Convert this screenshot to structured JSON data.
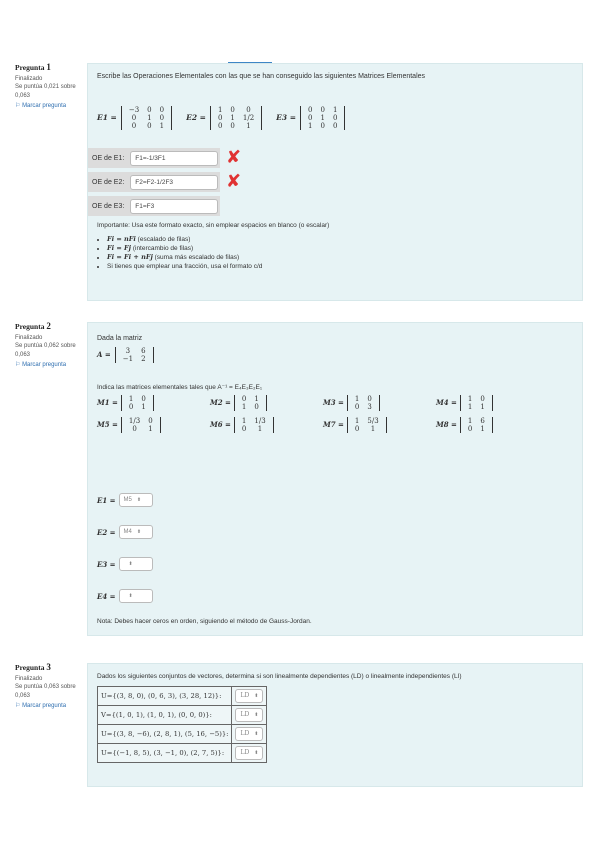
{
  "q1": {
    "info": {
      "title": "Pregunta",
      "number": "1",
      "status": "Finalizado",
      "score": "Se puntúa 0,021 sobre 0,063",
      "flag": "Marcar pregunta"
    },
    "prompt": "Escribe las Operaciones Elementales con las que se han conseguido las siguientes Matrices Elementales",
    "e1": {
      "label": "E1 =",
      "rows": [
        [
          "−3",
          "0",
          "0"
        ],
        [
          "0",
          "1",
          "0"
        ],
        [
          "0",
          "0",
          "1"
        ]
      ]
    },
    "e2": {
      "label": "E2 =",
      "rows": [
        [
          "1",
          "0",
          "0"
        ],
        [
          "0",
          "1",
          "1/2"
        ],
        [
          "0",
          "0",
          "1"
        ]
      ]
    },
    "e3": {
      "label": "E3 =",
      "rows": [
        [
          "0",
          "0",
          "1"
        ],
        [
          "0",
          "1",
          "0"
        ],
        [
          "1",
          "0",
          "0"
        ]
      ]
    },
    "answers": [
      {
        "label": "OE de E1:",
        "value": "F1=-1/3F1",
        "mark": "✘"
      },
      {
        "label": "OE de E2:",
        "value": "F2=F2-1/2F3",
        "mark": "✘"
      },
      {
        "label": "OE de E3:",
        "value": "F1=F3",
        "mark": ""
      }
    ],
    "important": "Importante: Usa este formato exacto, sin emplear espacios en blanco (o escalar)",
    "notes": [
      {
        "expr": "Fi = nFi",
        "desc": " (escalado de filas)"
      },
      {
        "expr": "Fi = Fj",
        "desc": " (intercambio de filas)"
      },
      {
        "expr": "Fi = Fi + nFj",
        "desc": " (suma más escalado de filas)"
      },
      {
        "expr": "",
        "desc": "Si tienes que emplear una fracción, usa el formato c/d"
      }
    ]
  },
  "q2": {
    "info": {
      "title": "Pregunta",
      "number": "2",
      "status": "Finalizado",
      "score": "Se puntúa 0,062 sobre 0,063",
      "flag": "Marcar pregunta"
    },
    "intro": "Dada la matriz",
    "a": {
      "label": "A =",
      "rows": [
        [
          "3",
          "6"
        ],
        [
          "−1",
          "2"
        ]
      ]
    },
    "prompt": "Indica las matrices elementales tales que A⁻¹ = E₄E₃E₂E₁",
    "mats": [
      {
        "label": "M1 =",
        "rows": [
          [
            "1",
            "0"
          ],
          [
            "0",
            "1"
          ]
        ]
      },
      {
        "label": "M2 =",
        "rows": [
          [
            "0",
            "1"
          ],
          [
            "1",
            "0"
          ]
        ]
      },
      {
        "label": "M3 =",
        "rows": [
          [
            "1",
            "0"
          ],
          [
            "0",
            "3"
          ]
        ]
      },
      {
        "label": "M4 =",
        "rows": [
          [
            "1",
            "0"
          ],
          [
            "1",
            "1"
          ]
        ]
      },
      {
        "label": "M5 =",
        "rows": [
          [
            "1/3",
            "0"
          ],
          [
            "0",
            "1"
          ]
        ]
      },
      {
        "label": "M6 =",
        "rows": [
          [
            "1",
            "1/3"
          ],
          [
            "0",
            "1"
          ]
        ]
      },
      {
        "label": "M7 =",
        "rows": [
          [
            "1",
            "5/3"
          ],
          [
            "0",
            "1"
          ]
        ]
      },
      {
        "label": "M8 =",
        "rows": [
          [
            "1",
            "6"
          ],
          [
            "0",
            "1"
          ]
        ]
      }
    ],
    "selects": [
      {
        "label": "E1 =",
        "value": "M5"
      },
      {
        "label": "E2 =",
        "value": "M4"
      },
      {
        "label": "E3 =",
        "value": ""
      },
      {
        "label": "E4 =",
        "value": ""
      }
    ],
    "note": "Nota: Debes hacer ceros en orden, siguiendo el método de Gauss-Jordan."
  },
  "q3": {
    "info": {
      "title": "Pregunta",
      "number": "3",
      "status": "Finalizado",
      "score": "Se puntúa 0,063 sobre 0,063",
      "flag": "Marcar pregunta"
    },
    "prompt": "Dados los siguientes conjuntos de vectores, determina si son linealmente dependientes (LD) o linealmente independientes (LI)",
    "rows": [
      {
        "set": "U={(3, 8, 0), (0, 6, 3), (3, 28, 12)}:",
        "value": "LD"
      },
      {
        "set": "V={(1, 0, 1), (1, 0, 1), (0, 0, 0)}:",
        "value": "LD"
      },
      {
        "set": "U={(3, 8, −6), (2, 8, 1), (5, 16, −5)}:",
        "value": "LD"
      },
      {
        "set": "U={(−1, 8, 5), (3, −1, 0), (2, 7, 5)}:",
        "value": "LD"
      }
    ]
  }
}
